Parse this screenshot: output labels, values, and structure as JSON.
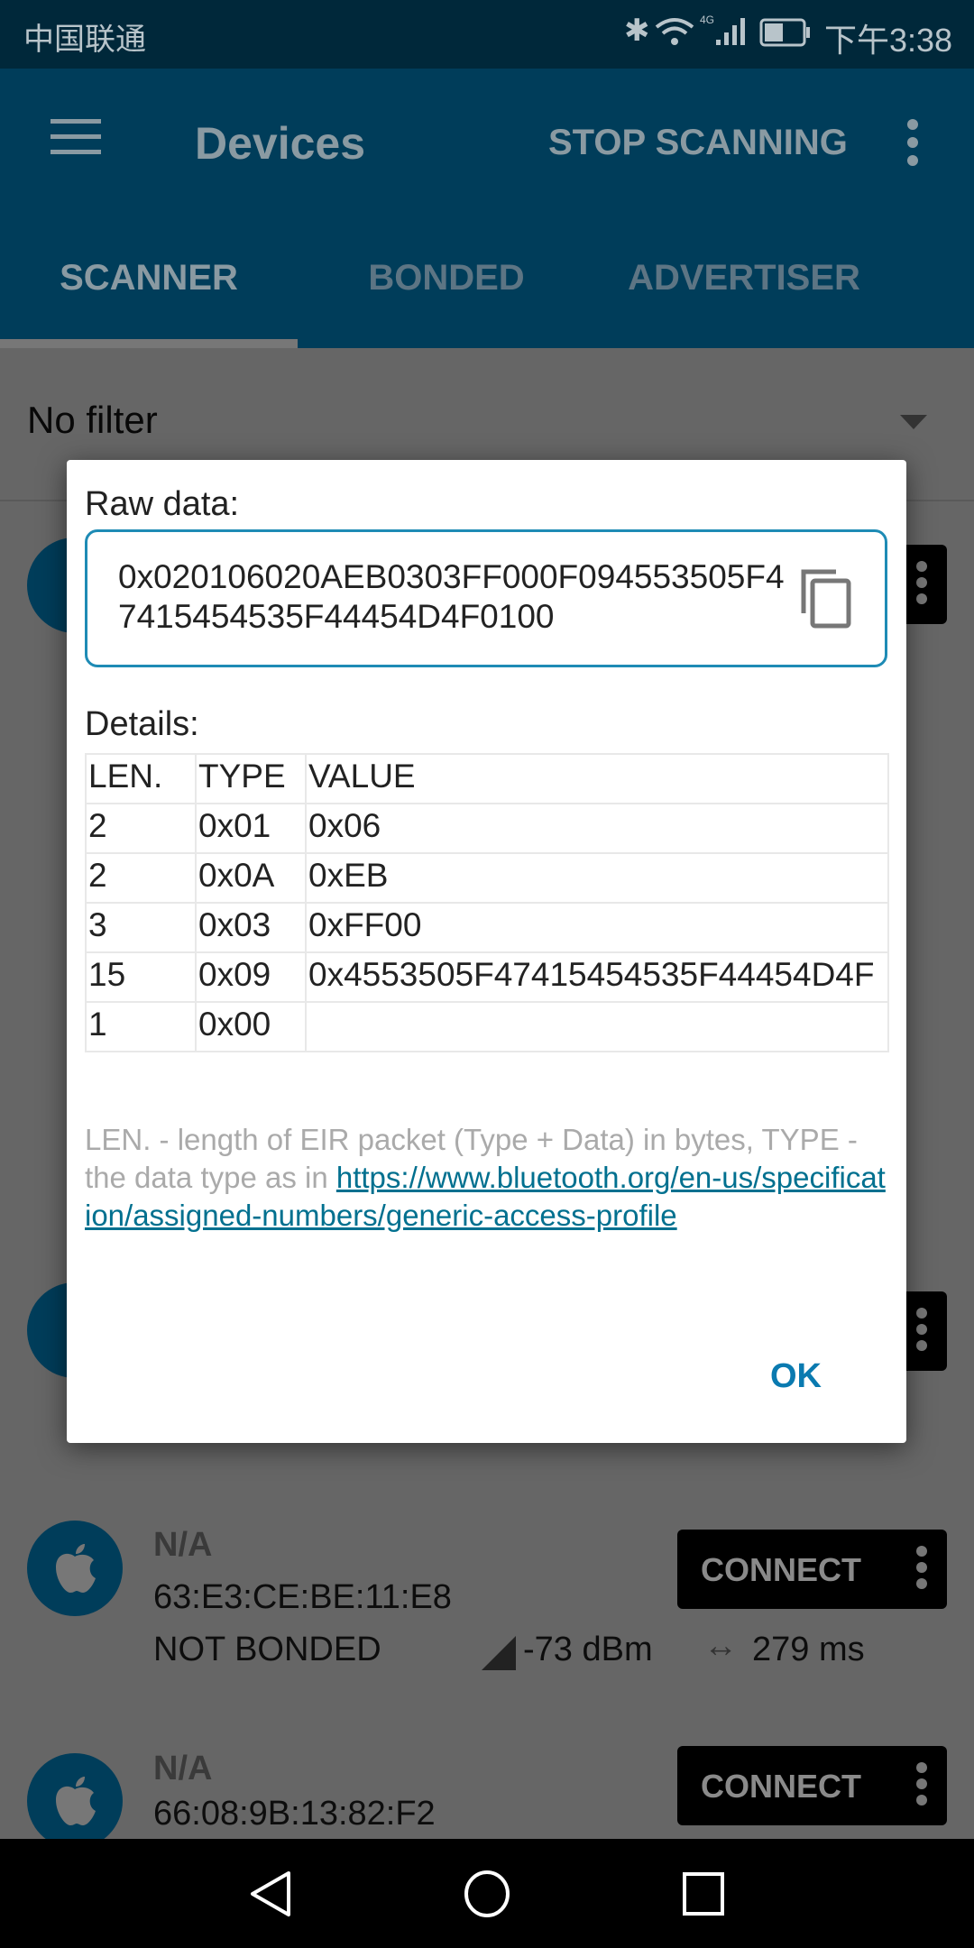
{
  "status_bar": {
    "carrier": "中国联通",
    "time": "下午3:38",
    "icons": [
      "bluetooth-icon",
      "wifi-icon",
      "4g-signal-icon",
      "battery-icon"
    ]
  },
  "app_bar": {
    "title": "Devices",
    "action": "STOP SCANNING",
    "menu_icon": "hamburger-icon",
    "overflow_icon": "more-vert-icon"
  },
  "tabs": [
    {
      "label": "SCANNER",
      "active": true
    },
    {
      "label": "BONDED",
      "active": false
    },
    {
      "label": "ADVERTISER",
      "active": false
    }
  ],
  "filter": {
    "value": "No filter"
  },
  "devices": [
    {
      "name": "N/A",
      "address": "63:E3:CE:BE:11:E8",
      "bond_state": "NOT BONDED",
      "rssi": "-73 dBm",
      "interval": "279 ms",
      "button": "CONNECT"
    },
    {
      "name": "N/A",
      "address": "66:08:9B:13:82:F2",
      "button": "CONNECT"
    }
  ],
  "dialog": {
    "raw_label": "Raw data:",
    "raw_value": "0x020106020AEB0303FF000F094553505F47415454535F44454D4F0100",
    "details_label": "Details:",
    "columns": [
      "LEN.",
      "TYPE",
      "VALUE"
    ],
    "rows": [
      [
        "2",
        "0x01",
        "0x06"
      ],
      [
        "2",
        "0x0A",
        "0xEB"
      ],
      [
        "3",
        "0x03",
        "0xFF00"
      ],
      [
        "15",
        "0x09",
        "0x4553505F47415454535F44454D4F"
      ],
      [
        "1",
        "0x00",
        ""
      ]
    ],
    "footnote": "LEN. - length of EIR packet (Type + Data) in bytes, TYPE - the data type as in ",
    "link": "https://www.bluetooth.org/en-us/specification/assigned-numbers/generic-access-profile",
    "ok": "OK"
  },
  "colors": {
    "primary": "#0098d8",
    "link": "#00708f",
    "accent": "#0a7ab0"
  }
}
